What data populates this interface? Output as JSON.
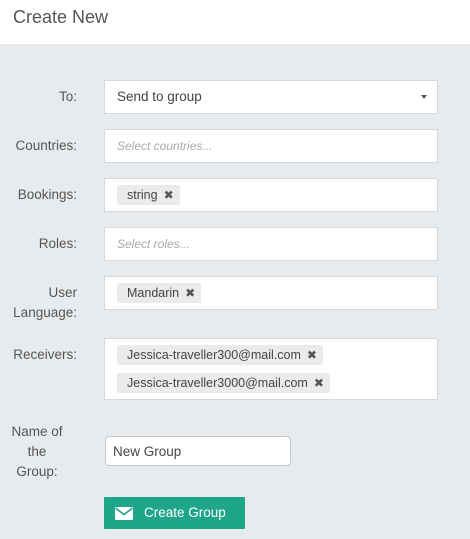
{
  "header": {
    "title": "Create New"
  },
  "form": {
    "to": {
      "label": "To:",
      "value": "Send to group"
    },
    "countries": {
      "label": "Countries:",
      "placeholder": "Select countries..."
    },
    "bookings": {
      "label": "Bookings:",
      "tags": [
        "string"
      ]
    },
    "roles": {
      "label": "Roles:",
      "placeholder": "Select roles..."
    },
    "user_language": {
      "label_line1": "User",
      "label_line2": "Language:",
      "tags": [
        "Mandarin"
      ]
    },
    "receivers": {
      "label": "Receivers:",
      "tags": [
        "Jessica-traveller300@mail.com",
        "Jessica-traveller3000@mail.com"
      ]
    },
    "group_name": {
      "label_line1": "Name of",
      "label_line2": "the",
      "label_line3": "Group:",
      "value": "New Group"
    },
    "submit": {
      "label": "Create Group",
      "icon": "envelope-icon"
    }
  },
  "colors": {
    "accent": "#1fa589",
    "background": "#e8ebed"
  },
  "remove_glyph": "✖"
}
